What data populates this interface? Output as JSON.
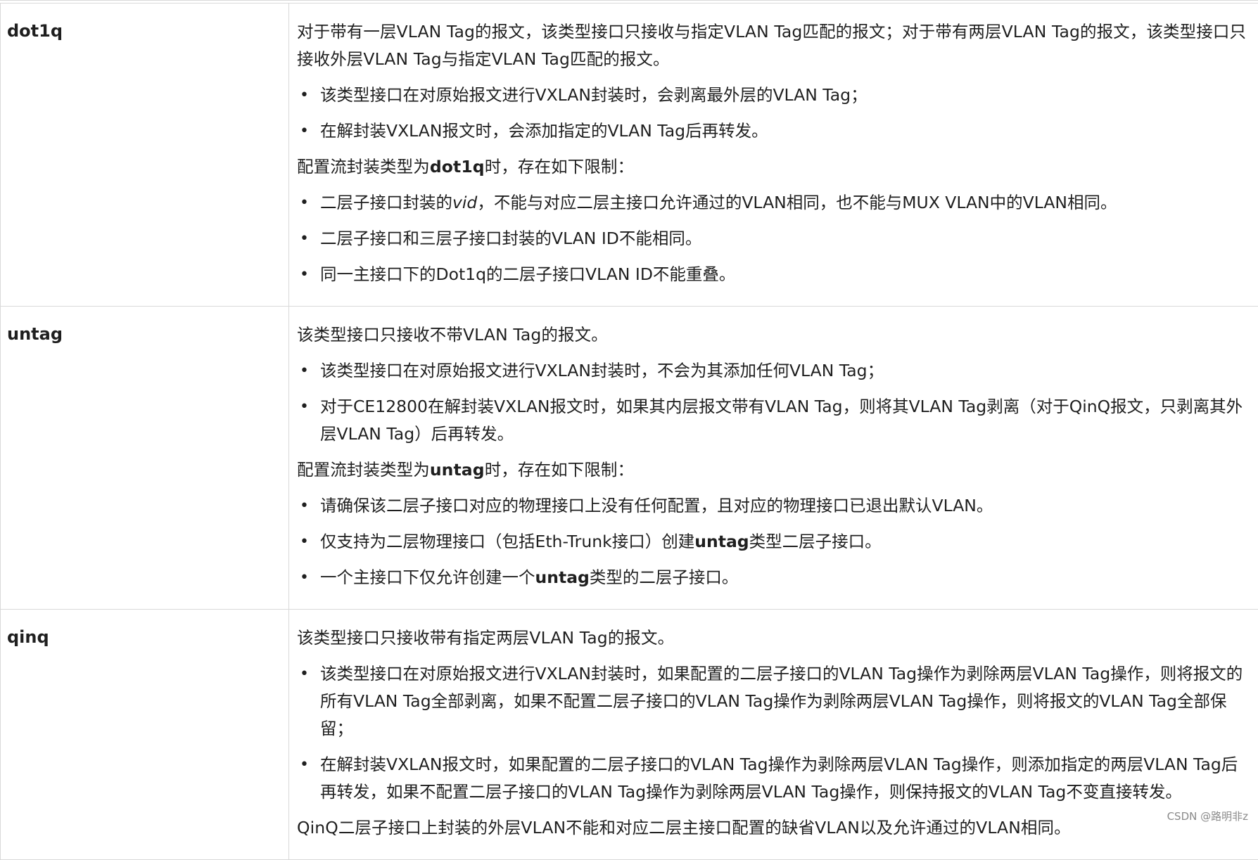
{
  "rows": [
    {
      "name": "dot1q",
      "blocks": [
        {
          "type": "para",
          "parts": [
            {
              "t": "对于带有一层VLAN Tag的报文，该类型接口只接收与指定VLAN Tag匹配的报文；对于带有两层VLAN Tag的报文，该类型接口只接收外层VLAN Tag与指定VLAN Tag匹配的报文。"
            }
          ]
        },
        {
          "type": "bullet",
          "parts": [
            {
              "t": "该类型接口在对原始报文进行VXLAN封装时，会剥离最外层的VLAN Tag；"
            }
          ]
        },
        {
          "type": "bullet",
          "parts": [
            {
              "t": "在解封装VXLAN报文时，会添加指定的VLAN Tag后再转发。"
            }
          ]
        },
        {
          "type": "para",
          "parts": [
            {
              "t": "配置流封装类型为"
            },
            {
              "t": "dot1q",
              "s": "b"
            },
            {
              "t": "时，存在如下限制："
            }
          ]
        },
        {
          "type": "bullet",
          "parts": [
            {
              "t": "二层子接口封装的"
            },
            {
              "t": "vid",
              "s": "i"
            },
            {
              "t": "，不能与对应二层主接口允许通过的VLAN相同，也不能与MUX VLAN中的VLAN相同。"
            }
          ]
        },
        {
          "type": "bullet",
          "parts": [
            {
              "t": "二层子接口和三层子接口封装的VLAN ID不能相同。"
            }
          ]
        },
        {
          "type": "bullet",
          "parts": [
            {
              "t": "同一主接口下的Dot1q的二层子接口VLAN ID不能重叠。"
            }
          ]
        }
      ]
    },
    {
      "name": "untag",
      "blocks": [
        {
          "type": "para",
          "parts": [
            {
              "t": "该类型接口只接收不带VLAN Tag的报文。"
            }
          ]
        },
        {
          "type": "bullet",
          "parts": [
            {
              "t": "该类型接口在对原始报文进行VXLAN封装时，不会为其添加任何VLAN Tag；"
            }
          ]
        },
        {
          "type": "bullet",
          "parts": [
            {
              "t": "对于CE12800在解封装VXLAN报文时，如果其内层报文带有VLAN Tag，则将其VLAN Tag剥离（对于QinQ报文，只剥离其外层VLAN Tag）后再转发。"
            }
          ]
        },
        {
          "type": "para",
          "parts": [
            {
              "t": "配置流封装类型为"
            },
            {
              "t": "untag",
              "s": "b"
            },
            {
              "t": "时，存在如下限制："
            }
          ]
        },
        {
          "type": "bullet",
          "parts": [
            {
              "t": "请确保该二层子接口对应的物理接口上没有任何配置，且对应的物理接口已退出默认VLAN。"
            }
          ]
        },
        {
          "type": "bullet",
          "parts": [
            {
              "t": "仅支持为二层物理接口（包括Eth-Trunk接口）创建"
            },
            {
              "t": "untag",
              "s": "b"
            },
            {
              "t": "类型二层子接口。"
            }
          ]
        },
        {
          "type": "bullet",
          "parts": [
            {
              "t": "一个主接口下仅允许创建一个"
            },
            {
              "t": "untag",
              "s": "b"
            },
            {
              "t": "类型的二层子接口。"
            }
          ]
        }
      ]
    },
    {
      "name": "qinq",
      "blocks": [
        {
          "type": "para",
          "parts": [
            {
              "t": "该类型接口只接收带有指定两层VLAN Tag的报文。"
            }
          ]
        },
        {
          "type": "bullet",
          "parts": [
            {
              "t": "该类型接口在对原始报文进行VXLAN封装时，如果配置的二层子接口的VLAN Tag操作为剥除两层VLAN Tag操作，则将报文的所有VLAN Tag全部剥离，如果不配置二层子接口的VLAN Tag操作为剥除两层VLAN Tag操作，则将报文的VLAN Tag全部保留；"
            }
          ]
        },
        {
          "type": "bullet",
          "parts": [
            {
              "t": "在解封装VXLAN报文时，如果配置的二层子接口的VLAN Tag操作为剥除两层VLAN Tag操作，则添加指定的两层VLAN Tag后再转发，如果不配置二层子接口的VLAN Tag操作为剥除两层VLAN Tag操作，则保持报文的VLAN Tag不变直接转发。"
            }
          ]
        },
        {
          "type": "para",
          "parts": [
            {
              "t": "QinQ二层子接口上封装的外层VLAN不能和对应二层主接口配置的缺省VLAN以及允许通过的VLAN相同。"
            }
          ]
        }
      ]
    }
  ],
  "bullet_symbol": "•",
  "watermark": "CSDN @路明非z"
}
